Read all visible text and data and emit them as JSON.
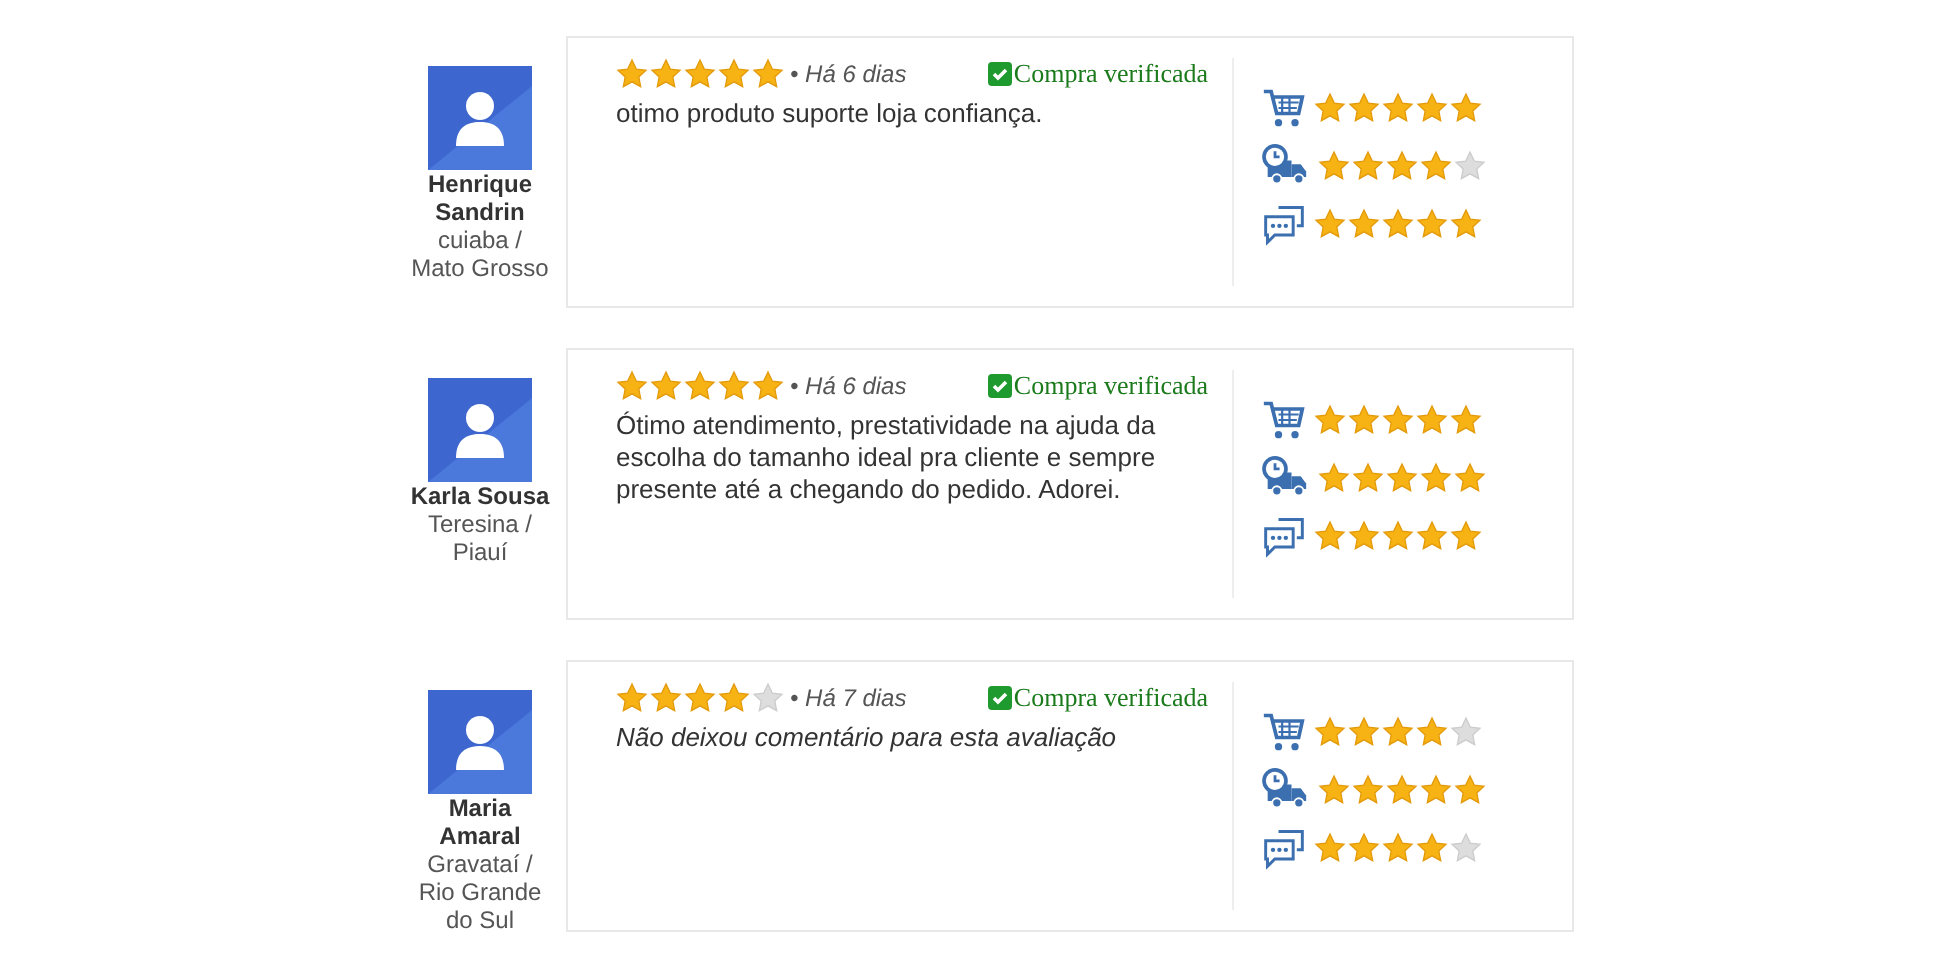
{
  "reviews": [
    {
      "name": "Henrique Sandrin",
      "location": "cuiaba / Mato Grosso",
      "stars": 5,
      "time": "• Há 6 dias",
      "verified": "Compra verificada",
      "kind": "comment",
      "comment": "otimo produto suporte loja confiança.",
      "ratings": [
        {
          "kind": "cart",
          "stars": 5
        },
        {
          "kind": "delivery",
          "stars": 4
        },
        {
          "kind": "service",
          "stars": 5
        }
      ]
    },
    {
      "name": "Karla Sousa",
      "location": "Teresina / Piauí",
      "stars": 5,
      "time": "• Há 6 dias",
      "verified": "Compra verificada",
      "kind": "comment",
      "comment": "Ótimo atendimento, prestatividade na ajuda da escolha do tamanho ideal pra cliente e sempre presente até a chegando do pedido. Adorei.",
      "ratings": [
        {
          "kind": "cart",
          "stars": 5
        },
        {
          "kind": "delivery",
          "stars": 5
        },
        {
          "kind": "service",
          "stars": 5
        }
      ]
    },
    {
      "name": "Maria Amaral",
      "location": "Gravataí / Rio Grande do Sul",
      "stars": 4,
      "time": "• Há 7 dias",
      "verified": "Compra verificada",
      "kind": "no_comment",
      "comment": "Não deixou comentário para esta avaliação",
      "ratings": [
        {
          "kind": "cart",
          "stars": 4
        },
        {
          "kind": "delivery",
          "stars": 5
        },
        {
          "kind": "service",
          "stars": 4
        }
      ]
    }
  ]
}
